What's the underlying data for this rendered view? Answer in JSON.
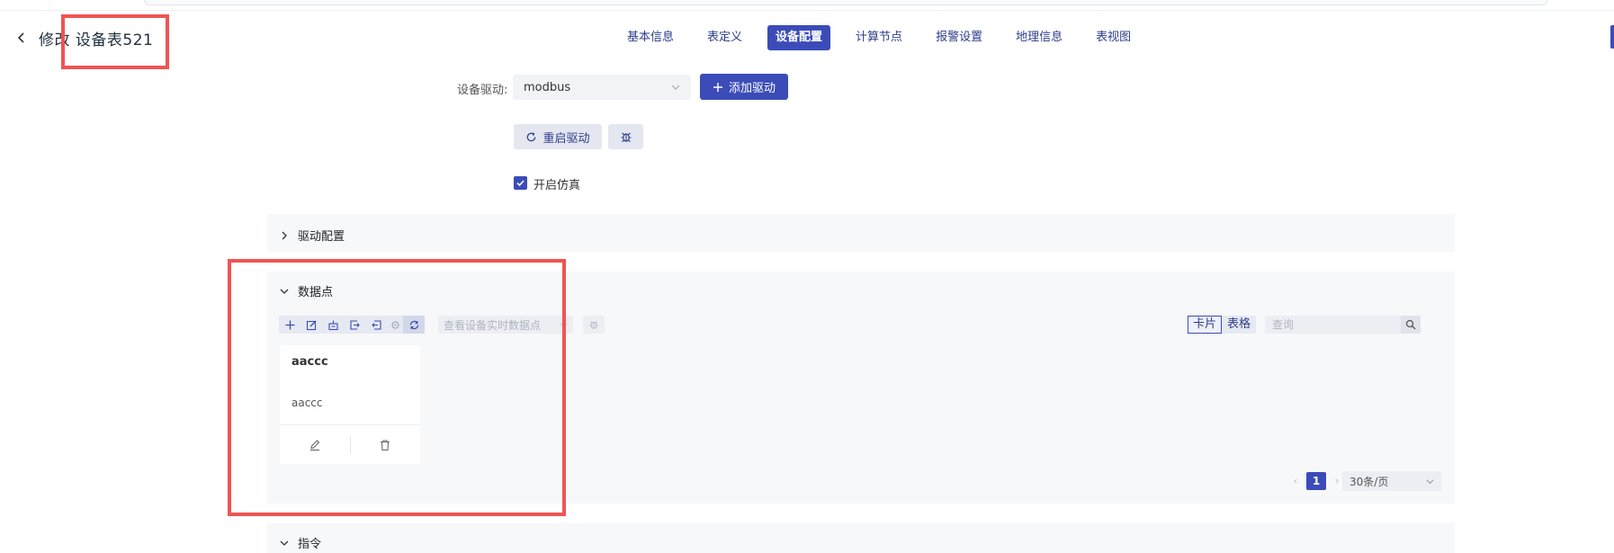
{
  "header": {
    "title_prefix": "修改",
    "title_name": "设备表521",
    "tabs": [
      {
        "label": "基本信息",
        "active": false
      },
      {
        "label": "表定义",
        "active": false
      },
      {
        "label": "设备配置",
        "active": true
      },
      {
        "label": "计算节点",
        "active": false
      },
      {
        "label": "报警设置",
        "active": false
      },
      {
        "label": "地理信息",
        "active": false
      },
      {
        "label": "表视图",
        "active": false
      }
    ]
  },
  "form": {
    "driver_label": "设备驱动:",
    "driver_value": "modbus",
    "add_driver_label": "添加驱动",
    "restart_driver_label": "重启驱动",
    "simulate_label": "开启仿真",
    "simulate_checked": true
  },
  "panels": {
    "driver_config": "驱动配置",
    "data_points": "数据点",
    "commands": "指令"
  },
  "toolbar": {
    "realtime_placeholder": "查看设备实时数据点",
    "view_card": "卡片",
    "view_table": "表格",
    "search_placeholder": "查询"
  },
  "cards": [
    {
      "title": "aaccc",
      "subtitle": "aaccc"
    }
  ],
  "pagination": {
    "current_page": "1",
    "page_size": "30条/页"
  },
  "colors": {
    "primary": "#3b4cb8",
    "annotation": "#f05454",
    "panel_bg": "#f7f8fa"
  },
  "icons": [
    "back-arrow-icon",
    "plus-icon",
    "chevron-down-icon",
    "refresh-icon",
    "bug-icon",
    "checkmark-icon",
    "chevron-right-icon",
    "edit-icon",
    "import-icon",
    "export-icon",
    "locate-icon",
    "search-icon",
    "pencil-icon",
    "trash-icon"
  ]
}
